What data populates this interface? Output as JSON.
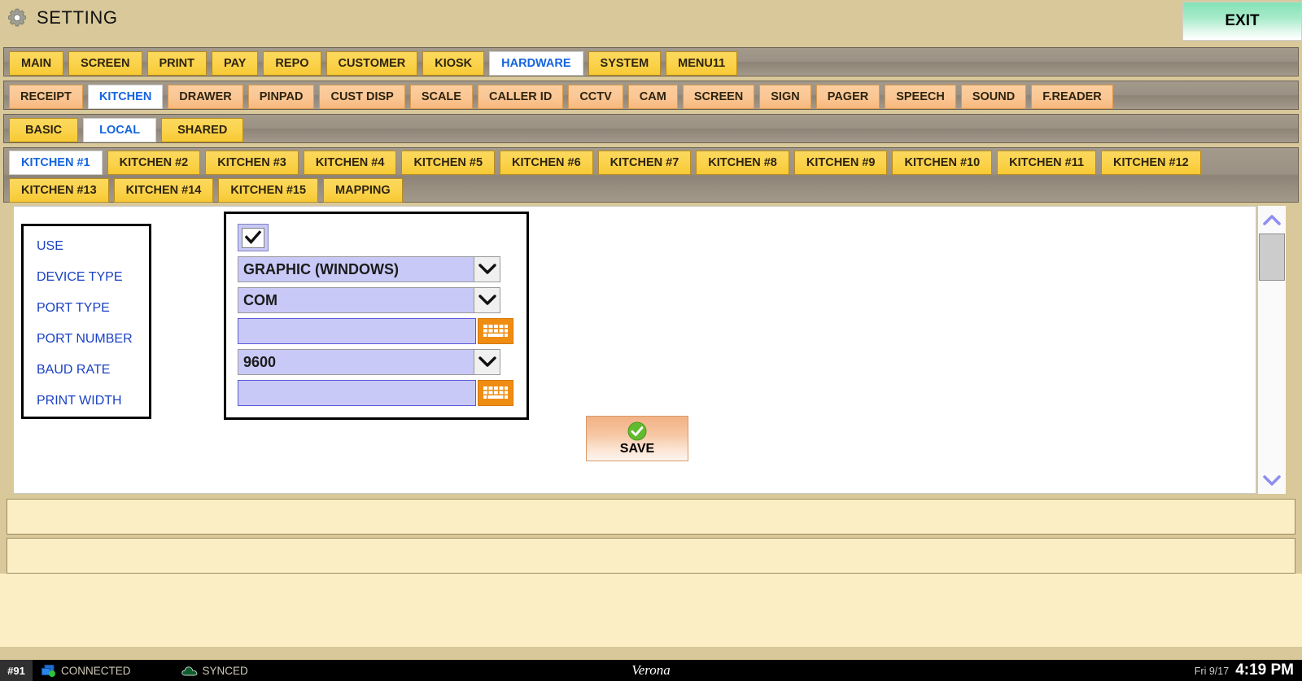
{
  "titlebar": {
    "icon": "gear-icon",
    "title": "SETTING",
    "exit_label": "EXIT"
  },
  "tabs_main": {
    "active": "HARDWARE",
    "items": [
      {
        "label": "MAIN"
      },
      {
        "label": "SCREEN"
      },
      {
        "label": "PRINT"
      },
      {
        "label": "PAY"
      },
      {
        "label": "REPO"
      },
      {
        "label": "CUSTOMER"
      },
      {
        "label": "KIOSK"
      },
      {
        "label": "HARDWARE"
      },
      {
        "label": "SYSTEM"
      },
      {
        "label": "MENU11"
      }
    ]
  },
  "tabs_device": {
    "active": "KITCHEN",
    "items": [
      {
        "label": "RECEIPT"
      },
      {
        "label": "KITCHEN"
      },
      {
        "label": "DRAWER"
      },
      {
        "label": "PINPAD"
      },
      {
        "label": "CUST DISP"
      },
      {
        "label": "SCALE"
      },
      {
        "label": "CALLER ID"
      },
      {
        "label": "CCTV"
      },
      {
        "label": "CAM"
      },
      {
        "label": "SCREEN"
      },
      {
        "label": "SIGN"
      },
      {
        "label": "PAGER"
      },
      {
        "label": "SPEECH"
      },
      {
        "label": "SOUND"
      },
      {
        "label": "F.READER"
      }
    ]
  },
  "tabs_scope": {
    "active": "LOCAL",
    "items": [
      {
        "label": "BASIC"
      },
      {
        "label": "LOCAL"
      },
      {
        "label": "SHARED"
      }
    ]
  },
  "tabs_kitchen": {
    "active": "KITCHEN #1",
    "items": [
      {
        "label": "KITCHEN #1"
      },
      {
        "label": "KITCHEN #2"
      },
      {
        "label": "KITCHEN #3"
      },
      {
        "label": "KITCHEN #4"
      },
      {
        "label": "KITCHEN #5"
      },
      {
        "label": "KITCHEN #6"
      },
      {
        "label": "KITCHEN #7"
      },
      {
        "label": "KITCHEN #8"
      },
      {
        "label": "KITCHEN #9"
      },
      {
        "label": "KITCHEN #10"
      },
      {
        "label": "KITCHEN #11"
      },
      {
        "label": "KITCHEN #12"
      },
      {
        "label": "KITCHEN #13"
      },
      {
        "label": "KITCHEN #14"
      },
      {
        "label": "KITCHEN #15"
      },
      {
        "label": "MAPPING"
      }
    ]
  },
  "form": {
    "labels": [
      {
        "text": "USE"
      },
      {
        "text": "DEVICE TYPE"
      },
      {
        "text": "PORT TYPE"
      },
      {
        "text": "PORT NUMBER"
      },
      {
        "text": "BAUD RATE"
      },
      {
        "text": "PRINT WIDTH"
      }
    ],
    "use_checked": true,
    "device_type": "GRAPHIC (WINDOWS)",
    "port_type": "COM",
    "port_number": "",
    "baud_rate": "9600",
    "print_width": "",
    "keyboard_icon": "keyboard-icon",
    "dropdown_icon": "chevron-down-icon"
  },
  "save": {
    "label": "SAVE",
    "icon": "check-circle-icon"
  },
  "scrollbar": {
    "up_icon": "chevron-up-icon",
    "down_icon": "chevron-down-icon"
  },
  "statusbar": {
    "station": "#91",
    "connection": "CONNECTED",
    "connection_icon": "network-icon",
    "sync": "SYNCED",
    "sync_icon": "cloud-icon",
    "brand": "Verona",
    "date": "Fri 9/17",
    "time": "4:19 PM"
  },
  "colors": {
    "accent_blue": "#1565e0",
    "tab_yellow": "#fbd24a",
    "tab_peach": "#fac694",
    "field_lavender": "#c9c9f7",
    "keyboard_orange": "#ef8c12",
    "page_cream": "#fbeec4",
    "titlebar_tan": "#d8c89a"
  }
}
